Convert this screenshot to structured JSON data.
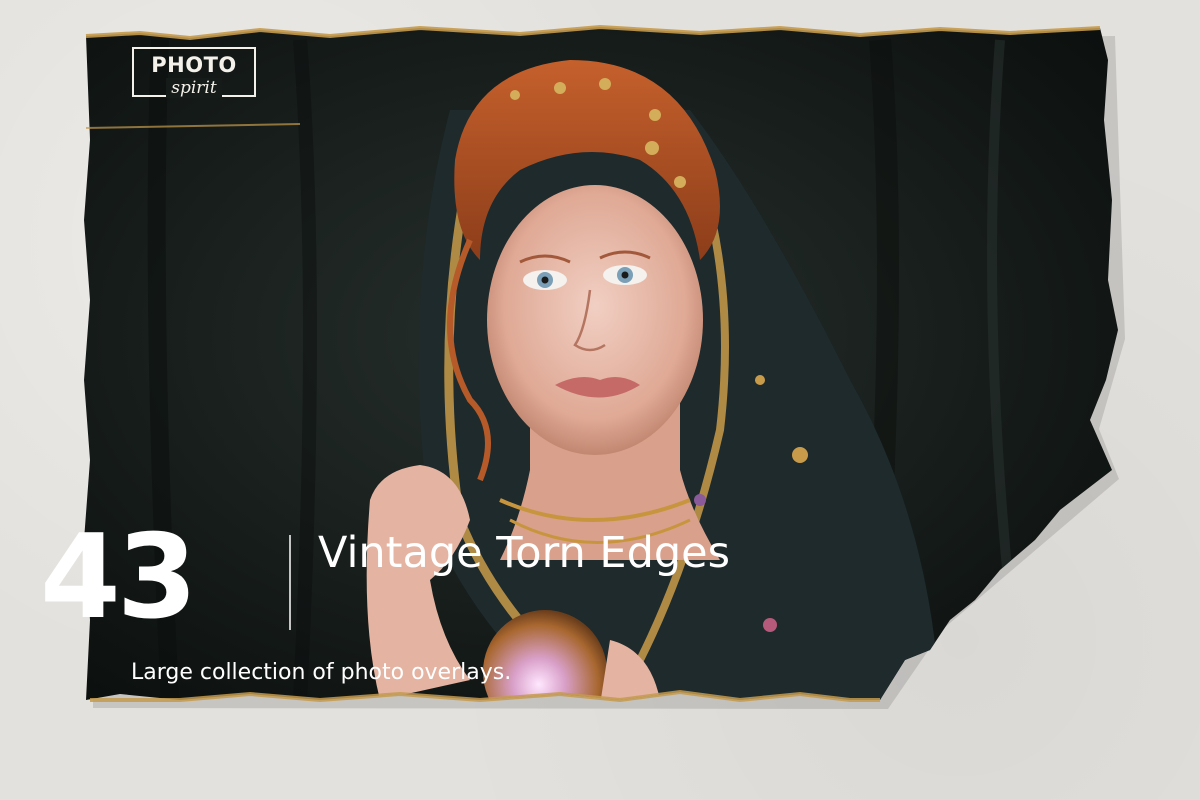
{
  "branding": {
    "logo_top": "PHOTO",
    "logo_bottom": "spirit"
  },
  "hero": {
    "count": "43",
    "title": "Vintage Torn Edges",
    "subtitle": "Large collection of photo overlays."
  }
}
